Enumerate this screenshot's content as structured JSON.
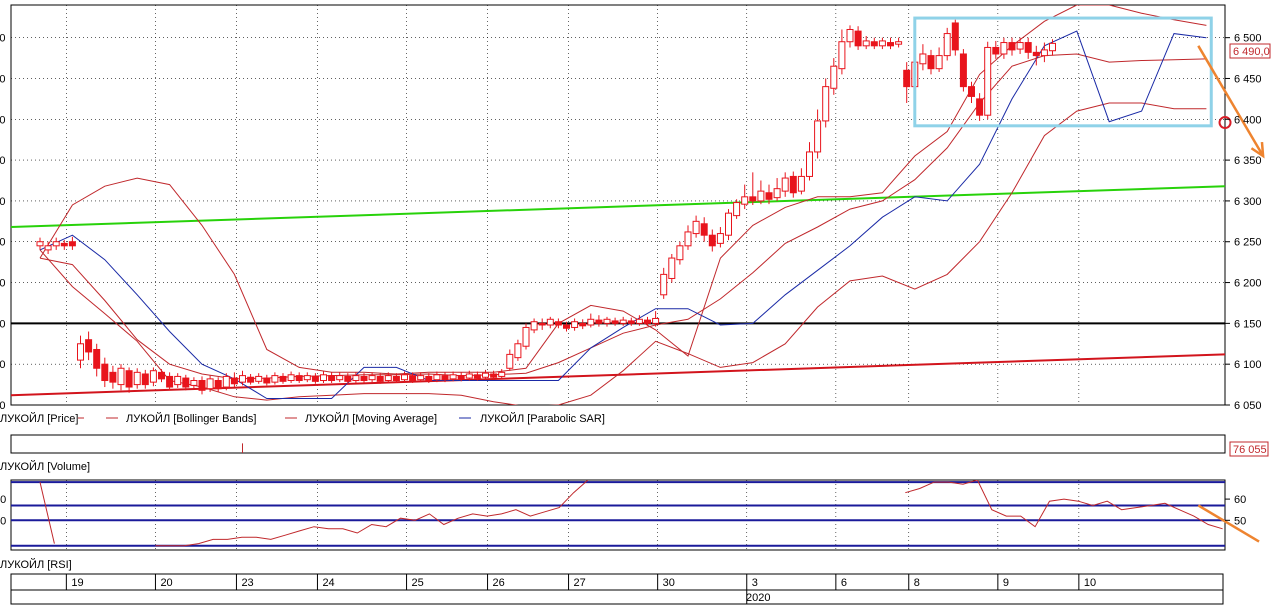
{
  "colors": {
    "candle": "#e8141c",
    "bollinger": "#c0282c",
    "moving_average": "#c0282c",
    "sar": "#1a2aa6",
    "trend_green": "#28d20a",
    "trend_red": "#d2141c",
    "level_black": "#000000",
    "box": "#8fd2e8",
    "arrow": "#ee8430",
    "rsi_lines": "#1a1a9a",
    "rsi": "#c0282c",
    "grid": "#000000",
    "price_label": "#c0282c"
  },
  "chart_data": [
    {
      "type": "candlestick",
      "ylim": [
        6050,
        6540
      ],
      "ticks": [
        "6 050",
        "6 100",
        "6 150",
        "6 200",
        "6 250",
        "6 300",
        "6 350",
        "6 400",
        "6 450",
        "6 500"
      ],
      "tick_values": [
        6050,
        6100,
        6150,
        6200,
        6250,
        6300,
        6350,
        6400,
        6450,
        6500
      ],
      "current_label": "6 490,0",
      "current_value": 6490,
      "legend": [
        {
          "label": "ЛУКОЙЛ [Price]"
        },
        {
          "label": "ЛУКОЙЛ [Bollinger Bands]"
        },
        {
          "label": "ЛУКОЙЛ [Moving Average]"
        },
        {
          "label": "ЛУКОЙЛ [Parabolic SAR]"
        }
      ],
      "levels": [
        {
          "name": "support-level",
          "value": 6150
        },
        {
          "name": "red-trendline",
          "from": 6062,
          "to": 6112
        },
        {
          "name": "green-trendline",
          "from": 6268,
          "to": 6318
        }
      ],
      "candles": [
        {
          "o": 6245,
          "c": 6250,
          "h": 6255,
          "l": 6240
        },
        {
          "o": 6240,
          "c": 6245,
          "h": 6250,
          "l": 6235
        },
        {
          "o": 6245,
          "c": 6250,
          "h": 6255,
          "l": 6240
        },
        {
          "o": 6248,
          "c": 6245,
          "h": 6252,
          "l": 6240
        },
        {
          "o": 6250,
          "c": 6245,
          "h": 6256,
          "l": 6240
        },
        {
          "o": 6105,
          "c": 6125,
          "h": 6135,
          "l": 6095
        },
        {
          "o": 6130,
          "c": 6115,
          "h": 6140,
          "l": 6105
        },
        {
          "o": 6118,
          "c": 6095,
          "h": 6125,
          "l": 6085
        },
        {
          "o": 6100,
          "c": 6080,
          "h": 6108,
          "l": 6072
        },
        {
          "o": 6090,
          "c": 6078,
          "h": 6098,
          "l": 6070
        },
        {
          "o": 6075,
          "c": 6095,
          "h": 6100,
          "l": 6068
        },
        {
          "o": 6092,
          "c": 6072,
          "h": 6096,
          "l": 6065
        },
        {
          "o": 6075,
          "c": 6090,
          "h": 6095,
          "l": 6070
        },
        {
          "o": 6088,
          "c": 6075,
          "h": 6093,
          "l": 6070
        },
        {
          "o": 6078,
          "c": 6092,
          "h": 6096,
          "l": 6073
        },
        {
          "o": 6090,
          "c": 6082,
          "h": 6094,
          "l": 6078
        },
        {
          "o": 6085,
          "c": 6072,
          "h": 6090,
          "l": 6068
        },
        {
          "o": 6075,
          "c": 6085,
          "h": 6089,
          "l": 6071
        },
        {
          "o": 6083,
          "c": 6072,
          "h": 6087,
          "l": 6068
        },
        {
          "o": 6074,
          "c": 6080,
          "h": 6084,
          "l": 6070
        },
        {
          "o": 6080,
          "c": 6068,
          "h": 6085,
          "l": 6063
        },
        {
          "o": 6070,
          "c": 6082,
          "h": 6086,
          "l": 6066
        },
        {
          "o": 6080,
          "c": 6070,
          "h": 6084,
          "l": 6066
        },
        {
          "o": 6072,
          "c": 6085,
          "h": 6089,
          "l": 6068
        },
        {
          "o": 6083,
          "c": 6076,
          "h": 6090,
          "l": 6072
        },
        {
          "o": 6078,
          "c": 6086,
          "h": 6092,
          "l": 6074
        },
        {
          "o": 6084,
          "c": 6078,
          "h": 6088,
          "l": 6075
        },
        {
          "o": 6079,
          "c": 6085,
          "h": 6089,
          "l": 6076
        },
        {
          "o": 6083,
          "c": 6077,
          "h": 6087,
          "l": 6074
        },
        {
          "o": 6078,
          "c": 6086,
          "h": 6090,
          "l": 6075
        },
        {
          "o": 6085,
          "c": 6079,
          "h": 6089,
          "l": 6076
        },
        {
          "o": 6080,
          "c": 6087,
          "h": 6091,
          "l": 6077
        },
        {
          "o": 6086,
          "c": 6080,
          "h": 6090,
          "l": 6077
        },
        {
          "o": 6081,
          "c": 6086,
          "h": 6090,
          "l": 6078
        },
        {
          "o": 6085,
          "c": 6079,
          "h": 6089,
          "l": 6076
        },
        {
          "o": 6080,
          "c": 6087,
          "h": 6091,
          "l": 6077
        },
        {
          "o": 6086,
          "c": 6080,
          "h": 6090,
          "l": 6077
        },
        {
          "o": 6081,
          "c": 6086,
          "h": 6090,
          "l": 6078
        },
        {
          "o": 6085,
          "c": 6079,
          "h": 6089,
          "l": 6076
        },
        {
          "o": 6080,
          "c": 6086,
          "h": 6090,
          "l": 6077
        },
        {
          "o": 6085,
          "c": 6080,
          "h": 6089,
          "l": 6077
        },
        {
          "o": 6081,
          "c": 6086,
          "h": 6090,
          "l": 6078
        },
        {
          "o": 6085,
          "c": 6079,
          "h": 6089,
          "l": 6076
        },
        {
          "o": 6080,
          "c": 6086,
          "h": 6090,
          "l": 6077
        },
        {
          "o": 6085,
          "c": 6080,
          "h": 6089,
          "l": 6077
        },
        {
          "o": 6081,
          "c": 6087,
          "h": 6091,
          "l": 6078
        },
        {
          "o": 6086,
          "c": 6080,
          "h": 6090,
          "l": 6077
        },
        {
          "o": 6081,
          "c": 6086,
          "h": 6090,
          "l": 6078
        },
        {
          "o": 6085,
          "c": 6080,
          "h": 6089,
          "l": 6077
        },
        {
          "o": 6081,
          "c": 6087,
          "h": 6091,
          "l": 6078
        },
        {
          "o": 6086,
          "c": 6081,
          "h": 6090,
          "l": 6078
        },
        {
          "o": 6082,
          "c": 6087,
          "h": 6091,
          "l": 6079
        },
        {
          "o": 6086,
          "c": 6082,
          "h": 6090,
          "l": 6079
        },
        {
          "o": 6083,
          "c": 6088,
          "h": 6092,
          "l": 6080
        },
        {
          "o": 6087,
          "c": 6083,
          "h": 6091,
          "l": 6080
        },
        {
          "o": 6084,
          "c": 6089,
          "h": 6093,
          "l": 6081
        },
        {
          "o": 6088,
          "c": 6084,
          "h": 6092,
          "l": 6081
        },
        {
          "o": 6085,
          "c": 6090,
          "h": 6094,
          "l": 6082
        },
        {
          "o": 6095,
          "c": 6112,
          "h": 6118,
          "l": 6092
        },
        {
          "o": 6108,
          "c": 6125,
          "h": 6130,
          "l": 6104
        },
        {
          "o": 6122,
          "c": 6145,
          "h": 6150,
          "l": 6118
        },
        {
          "o": 6142,
          "c": 6152,
          "h": 6156,
          "l": 6138
        },
        {
          "o": 6150,
          "c": 6148,
          "h": 6156,
          "l": 6142
        },
        {
          "o": 6148,
          "c": 6155,
          "h": 6158,
          "l": 6144
        },
        {
          "o": 6152,
          "c": 6148,
          "h": 6156,
          "l": 6144
        },
        {
          "o": 6148,
          "c": 6144,
          "h": 6152,
          "l": 6140
        },
        {
          "o": 6145,
          "c": 6152,
          "h": 6156,
          "l": 6141
        },
        {
          "o": 6150,
          "c": 6147,
          "h": 6155,
          "l": 6143
        },
        {
          "o": 6148,
          "c": 6155,
          "h": 6162,
          "l": 6145
        },
        {
          "o": 6154,
          "c": 6150,
          "h": 6160,
          "l": 6146
        },
        {
          "o": 6150,
          "c": 6155,
          "h": 6158,
          "l": 6146
        },
        {
          "o": 6153,
          "c": 6150,
          "h": 6157,
          "l": 6147
        },
        {
          "o": 6150,
          "c": 6154,
          "h": 6158,
          "l": 6147
        },
        {
          "o": 6153,
          "c": 6150,
          "h": 6157,
          "l": 6147
        },
        {
          "o": 6150,
          "c": 6155,
          "h": 6160,
          "l": 6147
        },
        {
          "o": 6154,
          "c": 6150,
          "h": 6158,
          "l": 6147
        },
        {
          "o": 6150,
          "c": 6156,
          "h": 6165,
          "l": 6146
        },
        {
          "o": 6185,
          "c": 6210,
          "h": 6218,
          "l": 6180
        },
        {
          "o": 6205,
          "c": 6230,
          "h": 6235,
          "l": 6200
        },
        {
          "o": 6228,
          "c": 6245,
          "h": 6250,
          "l": 6222
        },
        {
          "o": 6245,
          "c": 6262,
          "h": 6270,
          "l": 6240
        },
        {
          "o": 6260,
          "c": 6275,
          "h": 6282,
          "l": 6255
        },
        {
          "o": 6272,
          "c": 6258,
          "h": 6280,
          "l": 6250
        },
        {
          "o": 6258,
          "c": 6245,
          "h": 6265,
          "l": 6238
        },
        {
          "o": 6248,
          "c": 6260,
          "h": 6268,
          "l": 6243
        },
        {
          "o": 6258,
          "c": 6285,
          "h": 6290,
          "l": 6252
        },
        {
          "o": 6282,
          "c": 6298,
          "h": 6302,
          "l": 6278
        },
        {
          "o": 6296,
          "c": 6305,
          "h": 6320,
          "l": 6290
        },
        {
          "o": 6305,
          "c": 6300,
          "h": 6335,
          "l": 6295
        },
        {
          "o": 6300,
          "c": 6312,
          "h": 6325,
          "l": 6296
        },
        {
          "o": 6310,
          "c": 6302,
          "h": 6320,
          "l": 6296
        },
        {
          "o": 6304,
          "c": 6315,
          "h": 6328,
          "l": 6300
        },
        {
          "o": 6312,
          "c": 6328,
          "h": 6335,
          "l": 6305
        },
        {
          "o": 6330,
          "c": 6310,
          "h": 6336,
          "l": 6304
        },
        {
          "o": 6312,
          "c": 6330,
          "h": 6340,
          "l": 6308
        },
        {
          "o": 6330,
          "c": 6360,
          "h": 6372,
          "l": 6325
        },
        {
          "o": 6360,
          "c": 6398,
          "h": 6412,
          "l": 6352
        },
        {
          "o": 6398,
          "c": 6440,
          "h": 6450,
          "l": 6390
        },
        {
          "o": 6438,
          "c": 6465,
          "h": 6475,
          "l": 6430
        },
        {
          "o": 6462,
          "c": 6495,
          "h": 6510,
          "l": 6455
        },
        {
          "o": 6495,
          "c": 6510,
          "h": 6515,
          "l": 6488
        },
        {
          "o": 6508,
          "c": 6490,
          "h": 6514,
          "l": 6485
        },
        {
          "o": 6490,
          "c": 6496,
          "h": 6502,
          "l": 6486
        },
        {
          "o": 6495,
          "c": 6490,
          "h": 6500,
          "l": 6486
        },
        {
          "o": 6490,
          "c": 6496,
          "h": 6500,
          "l": 6486
        },
        {
          "o": 6494,
          "c": 6490,
          "h": 6500,
          "l": 6486
        },
        {
          "o": 6492,
          "c": 6495,
          "h": 6500,
          "l": 6488
        },
        {
          "o": 6460,
          "c": 6440,
          "h": 6470,
          "l": 6420
        },
        {
          "o": 6440,
          "c": 6470,
          "h": 6475,
          "l": 6400
        },
        {
          "o": 6468,
          "c": 6480,
          "h": 6492,
          "l": 6460
        },
        {
          "o": 6478,
          "c": 6462,
          "h": 6485,
          "l": 6455
        },
        {
          "o": 6462,
          "c": 6478,
          "h": 6488,
          "l": 6458
        },
        {
          "o": 6478,
          "c": 6505,
          "h": 6512,
          "l": 6472
        },
        {
          "o": 6518,
          "c": 6485,
          "h": 6522,
          "l": 6478
        },
        {
          "o": 6480,
          "c": 6440,
          "h": 6486,
          "l": 6434
        },
        {
          "o": 6440,
          "c": 6428,
          "h": 6446,
          "l": 6420
        },
        {
          "o": 6425,
          "c": 6405,
          "h": 6432,
          "l": 6398
        },
        {
          "o": 6405,
          "c": 6488,
          "h": 6495,
          "l": 6400
        },
        {
          "o": 6488,
          "c": 6480,
          "h": 6496,
          "l": 6474
        },
        {
          "o": 6480,
          "c": 6494,
          "h": 6500,
          "l": 6474
        },
        {
          "o": 6494,
          "c": 6485,
          "h": 6500,
          "l": 6478
        },
        {
          "o": 6486,
          "c": 6494,
          "h": 6500,
          "l": 6480
        },
        {
          "o": 6494,
          "c": 6482,
          "h": 6500,
          "l": 6474
        },
        {
          "o": 6482,
          "c": 6478,
          "h": 6490,
          "l": 6466
        },
        {
          "o": 6478,
          "c": 6485,
          "h": 6494,
          "l": 6470
        },
        {
          "o": 6484,
          "c": 6493,
          "h": 6498,
          "l": 6478
        }
      ],
      "bollinger_upper": [
        6230,
        6295,
        6318,
        6328,
        6320,
        6270,
        6210,
        6118,
        6096,
        6090,
        6090,
        6088,
        6090,
        6090,
        6090,
        6095,
        6150,
        6172,
        6165,
        6142,
        6110,
        6230,
        6270,
        6292,
        6305,
        6305,
        6310,
        6355,
        6385,
        6455,
        6490,
        6520,
        6540,
        6540,
        6530,
        6522,
        6515
      ],
      "bollinger_lower": [
        6240,
        6195,
        6162,
        6128,
        6080,
        6072,
        6060,
        6056,
        6060,
        6062,
        6064,
        6064,
        6064,
        6062,
        6054,
        6048,
        6050,
        6062,
        6092,
        6128,
        6113,
        6096,
        6102,
        6125,
        6170,
        6202,
        6208,
        6192,
        6210,
        6250,
        6310,
        6380,
        6410,
        6420,
        6420,
        6413,
        6413
      ],
      "moving_average": [
        6230,
        6222,
        6178,
        6130,
        6100,
        6088,
        6082,
        6083,
        6085,
        6086,
        6087,
        6087,
        6088,
        6086,
        6087,
        6089,
        6102,
        6120,
        6138,
        6148,
        6155,
        6180,
        6212,
        6248,
        6268,
        6290,
        6300,
        6326,
        6365,
        6420,
        6465,
        6478,
        6480,
        6470,
        6472,
        6473,
        6474
      ],
      "sar": [
        6240,
        6258,
        6228,
        6185,
        6140,
        6100,
        6082,
        6058,
        6058,
        6058,
        6096,
        6096,
        6080,
        6080,
        6080,
        6080,
        6080,
        6120,
        6145,
        6168,
        6168,
        6148,
        6150,
        6185,
        6215,
        6245,
        6280,
        6305,
        6300,
        6345,
        6425,
        6490,
        6508,
        6397,
        6410,
        6505,
        6500
      ],
      "annotations": {
        "box": {
          "t_from": 108,
          "t_to": 144.6,
          "v_top": 6524,
          "v_bottom": 6392
        },
        "arrow_from": {
          "t": 143,
          "v": 6490
        },
        "arrow_to": {
          "t": 151,
          "v": 6355
        },
        "target_circle": {
          "t": 146.3,
          "v": 6396
        }
      }
    },
    {
      "type": "bar",
      "title": "ЛУКОЙЛ [Volume]",
      "current_label": "76 055",
      "ylim": [
        0,
        3
      ],
      "values": [
        {
          "t": 25,
          "v": 1.6
        }
      ]
    },
    {
      "type": "line",
      "title": "ЛУКОЙЛ [RSI]",
      "ylim": [
        36,
        69
      ],
      "ticks": [
        "50",
        "60"
      ],
      "tick_values": [
        50,
        60
      ],
      "levels": [
        38,
        50,
        57,
        68
      ],
      "values": [
        68,
        39,
        null,
        null,
        null,
        null,
        null,
        null,
        38,
        38,
        38,
        39,
        41,
        41,
        42,
        42,
        41,
        43,
        45,
        47,
        46,
        46,
        44,
        48,
        47,
        51,
        50,
        53,
        48,
        51,
        53,
        52,
        53,
        55,
        52,
        54,
        56,
        63,
        69,
        null,
        null,
        null,
        null,
        null,
        null,
        null,
        null,
        null,
        null,
        null,
        null,
        null,
        null,
        null,
        null,
        null,
        null,
        null,
        null,
        null,
        63,
        65,
        68,
        68,
        67,
        69,
        55,
        52,
        52,
        47,
        59,
        60,
        59,
        57,
        59,
        55,
        56,
        57,
        58,
        55,
        52,
        48,
        46
      ]
    }
  ],
  "time_axis": {
    "day_labels": [
      "19",
      "20",
      "23",
      "24",
      "25",
      "26",
      "27",
      "30",
      "3",
      "6",
      "8",
      "9",
      "10"
    ],
    "day_starts": [
      4,
      15,
      25,
      35,
      46,
      56,
      66,
      77,
      88,
      99,
      108,
      119,
      129
    ],
    "year_label": "2020"
  }
}
